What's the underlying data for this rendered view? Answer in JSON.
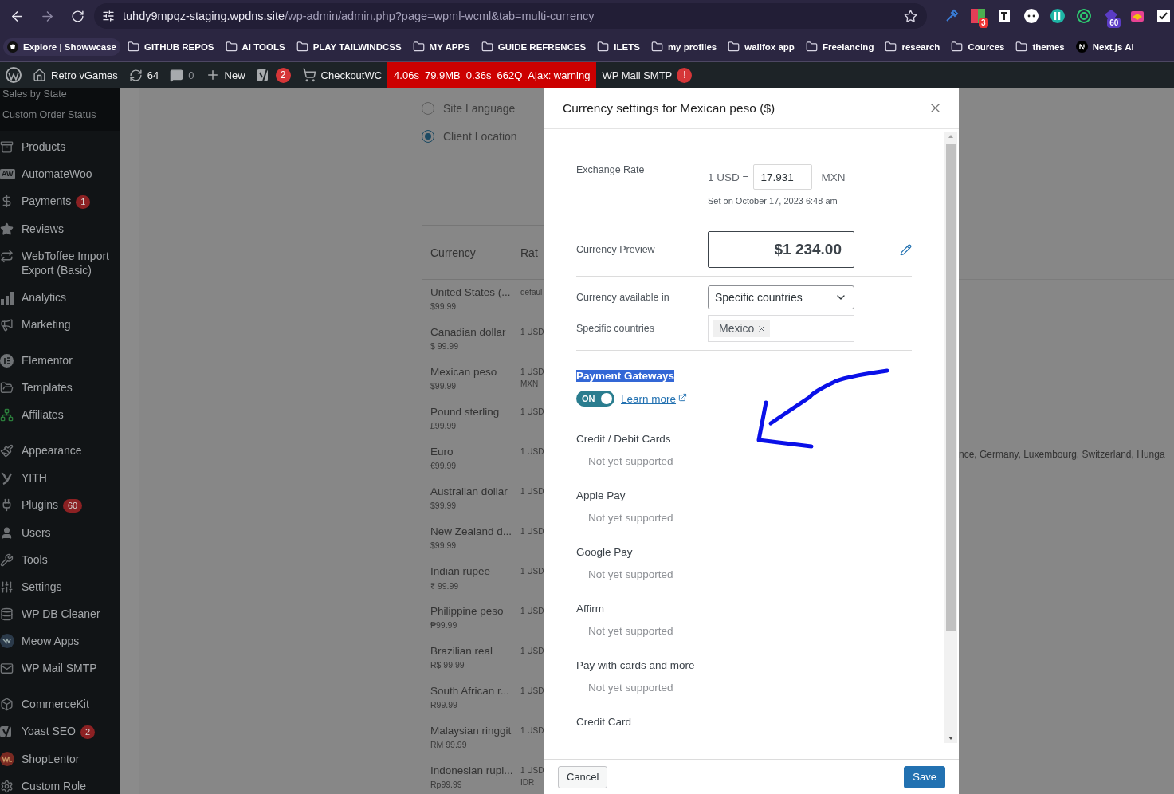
{
  "browser": {
    "url_host": "tuhdy9mpqz-staging.wpdns.site",
    "url_path": "/wp-admin/admin.php?page=wpml-wcml&tab=multi-currency",
    "extensions": [
      {
        "kind": "dropper"
      },
      {
        "kind": "tiles",
        "badge": "3"
      },
      {
        "kind": "page"
      },
      {
        "kind": "dots"
      },
      {
        "kind": "bars"
      },
      {
        "kind": "target"
      },
      {
        "kind": "gem",
        "badge": "60"
      },
      {
        "kind": "flag"
      },
      {
        "kind": "check"
      }
    ],
    "bookmarks": [
      {
        "label": "Explore | Showwcase",
        "kind": "site"
      },
      {
        "label": "GITHUB REPOS",
        "kind": "folder"
      },
      {
        "label": "AI TOOLS",
        "kind": "folder"
      },
      {
        "label": "PLAY TAILWINDCSS",
        "kind": "folder"
      },
      {
        "label": "MY APPS",
        "kind": "folder"
      },
      {
        "label": "GUIDE REFRENCES",
        "kind": "folder"
      },
      {
        "label": "ILETS",
        "kind": "folder"
      },
      {
        "label": "my profiles",
        "kind": "folder"
      },
      {
        "label": "wallfox app",
        "kind": "folder"
      },
      {
        "label": "Freelancing",
        "kind": "folder"
      },
      {
        "label": "research",
        "kind": "folder"
      },
      {
        "label": "Cources",
        "kind": "folder"
      },
      {
        "label": "themes",
        "kind": "folder"
      },
      {
        "label": "Next.js AI",
        "kind": "next"
      }
    ]
  },
  "admin_bar": {
    "site": "Retro vGames",
    "updates": "64",
    "comments": "0",
    "new": "New",
    "yoast_count": "2",
    "checkout": "CheckoutWC",
    "query_monitor": [
      "4.06s",
      "79.9MB",
      "0.36s",
      "662Q",
      "Ajax: warning"
    ],
    "smtp": "WP Mail SMTP",
    "smtp_alert": "!"
  },
  "sidebar": {
    "submenu": [
      "Sales by State",
      "Custom Order Status"
    ],
    "groups": [
      [
        {
          "label": "Products",
          "kind": "archive"
        },
        {
          "label": "AutomateWoo",
          "kind": "monogram",
          "icon_text": "AW"
        },
        {
          "label": "Payments",
          "kind": "dollar",
          "badge": "1"
        },
        {
          "label": "Reviews",
          "kind": "star"
        },
        {
          "label": "WebToffee Import Export (Basic)",
          "kind": "repeat"
        },
        {
          "label": "Analytics",
          "kind": "bars"
        },
        {
          "label": "Marketing",
          "kind": "megaphone"
        }
      ],
      [
        {
          "label": "Elementor",
          "kind": "elementor"
        },
        {
          "label": "Templates",
          "kind": "folder"
        },
        {
          "label": "Affiliates",
          "kind": "network"
        }
      ],
      [
        {
          "label": "Appearance",
          "kind": "brush"
        },
        {
          "label": "YITH",
          "kind": "yith"
        },
        {
          "label": "Plugins",
          "kind": "plug",
          "badge": "60"
        },
        {
          "label": "Users",
          "kind": "user"
        },
        {
          "label": "Tools",
          "kind": "wrench"
        },
        {
          "label": "Settings",
          "kind": "sliders"
        },
        {
          "label": "WP DB Cleaner",
          "kind": "database"
        },
        {
          "label": "Meow Apps",
          "kind": "meow"
        },
        {
          "label": "WP Mail SMTP",
          "kind": "mail"
        }
      ],
      [
        {
          "label": "CommerceKit",
          "kind": "box"
        },
        {
          "label": "Yoast SEO",
          "kind": "yoast",
          "badge": "2"
        },
        {
          "label": "ShopLentor",
          "kind": "shoplentor"
        },
        {
          "label": "Custom Role",
          "kind": "gear"
        }
      ]
    ]
  },
  "content": {
    "radios": [
      {
        "label": "Site Language",
        "selected": false
      },
      {
        "label": "Client Location",
        "selected": true
      }
    ],
    "table": {
      "columns": [
        "Currency",
        "Rat"
      ],
      "rows": [
        {
          "name": "United States (...",
          "price": "$99.99",
          "rate": [
            "defaul"
          ]
        },
        {
          "name": "Canadian dollar",
          "price": "$ 99.99",
          "rate": [
            "1 USD"
          ]
        },
        {
          "name": "Mexican peso",
          "price": "$99.99",
          "rate": [
            "1 USD",
            "MXN"
          ]
        },
        {
          "name": "Pound sterling",
          "price": "£99.99",
          "rate": [
            "1 USD"
          ]
        },
        {
          "name": "Euro",
          "price": "€99.99",
          "rate": [
            "1 USD"
          ]
        },
        {
          "name": "Australian dollar",
          "price": "$99.99",
          "rate": [
            "1 USD"
          ]
        },
        {
          "name": "New Zealand d...",
          "price": "$99.99",
          "rate": [
            "1 USD"
          ]
        },
        {
          "name": "Indian rupee",
          "price": "₹ 99.99",
          "rate": [
            "1 USD"
          ]
        },
        {
          "name": "Philippine peso",
          "price": "₱99.99",
          "rate": [
            "1 USD"
          ]
        },
        {
          "name": "Brazilian real",
          "price": "R$ 99,99",
          "rate": [
            "1 USD"
          ]
        },
        {
          "name": "South African r...",
          "price": "R99.99",
          "rate": [
            "1 USD"
          ]
        },
        {
          "name": "Malaysian ringgit",
          "price": "RM 99.99",
          "rate": [
            "1 USD"
          ]
        },
        {
          "name": "Indonesian rupi...",
          "price": "Rp99.99",
          "rate": [
            "1 USD",
            "IDR"
          ]
        }
      ]
    },
    "countries_text": "nce, Germany, Luxembourg, Switzerland, Hunga"
  },
  "modal": {
    "title": "Currency settings for Mexican peso ($)",
    "exchange_rate": {
      "label": "Exchange Rate",
      "prefix": "1 USD =",
      "value": "17.931",
      "suffix": "MXN",
      "note": "Set on October 17, 2023 6:48 am"
    },
    "preview": {
      "label": "Currency Preview",
      "value": "$1 234.00"
    },
    "availability": {
      "label": "Currency available in",
      "value": "Specific countries"
    },
    "countries": {
      "label": "Specific countries",
      "tags": [
        "Mexico"
      ]
    },
    "gateways": {
      "heading": "Payment Gateways",
      "highlighted": true,
      "toggle": {
        "on": true,
        "label": "ON"
      },
      "link": "Learn more",
      "items": [
        {
          "name": "Credit / Debit Cards",
          "status": "Not yet supported"
        },
        {
          "name": "Apple Pay",
          "status": "Not yet supported"
        },
        {
          "name": "Google Pay",
          "status": "Not yet supported"
        },
        {
          "name": "Affirm",
          "status": "Not yet supported"
        },
        {
          "name": "Pay with cards and more",
          "status": "Not yet supported"
        },
        {
          "name": "Credit Card"
        }
      ]
    },
    "buttons": [
      {
        "label": "Cancel",
        "kind": "secondary"
      },
      {
        "label": "Save",
        "kind": "primary"
      }
    ]
  }
}
